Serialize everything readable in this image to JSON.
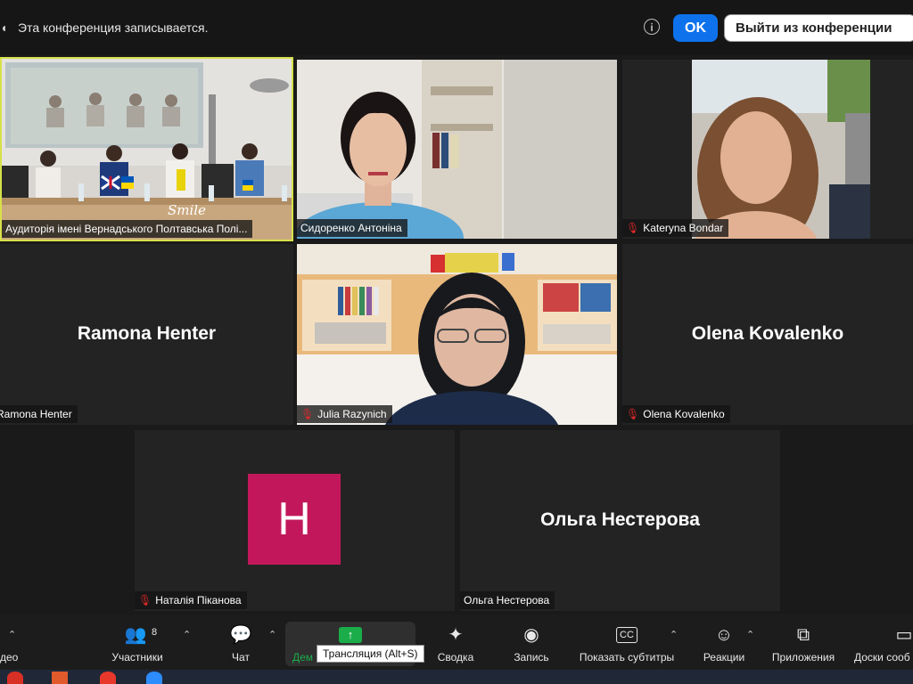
{
  "banner": {
    "recording_text": "Эта конференция записывается.",
    "ok_label": "OK",
    "leave_label": "Выйти из конференции"
  },
  "tiles": [
    {
      "id": "room",
      "name": "Аудиторія імені Вернадського Полтавська Полі..."
    },
    {
      "id": "sidorenko",
      "name": "Сидоренко Антоніна"
    },
    {
      "id": "bondar",
      "name": "Kateryna Bondar"
    },
    {
      "id": "henter",
      "name": "Ramona Henter",
      "center_name": "Ramona Henter"
    },
    {
      "id": "razynich",
      "name": "Julia Razynich"
    },
    {
      "id": "kovalenko",
      "name": "Olena Kovalenko",
      "center_name": "Olena Kovalenko"
    },
    {
      "id": "pikanova",
      "name": "Наталія Піканова",
      "avatar_letter": "H",
      "avatar_color": "#c2185b"
    },
    {
      "id": "nesterova",
      "name": "Ольга Нестерова",
      "center_name": "Ольга Нестерова"
    }
  ],
  "room_scene": {
    "sign": "Smile"
  },
  "toolbar": {
    "video_label": "део",
    "participants_label": "Участники",
    "participants_count": "8",
    "chat_label": "Чат",
    "share_label": "Дем",
    "tooltip": "Трансляция (Alt+S)",
    "summary_label": "Сводка",
    "record_label": "Запись",
    "captions_label": "Показать субтитры",
    "reactions_label": "Реакции",
    "apps_label": "Приложения",
    "docs_label": "Доски сооб"
  },
  "colors": {
    "accent_blue": "#0e72ed",
    "active_speaker_border": "#d7e14a",
    "share_green": "#1aad4a",
    "muted_red": "#e02828"
  }
}
